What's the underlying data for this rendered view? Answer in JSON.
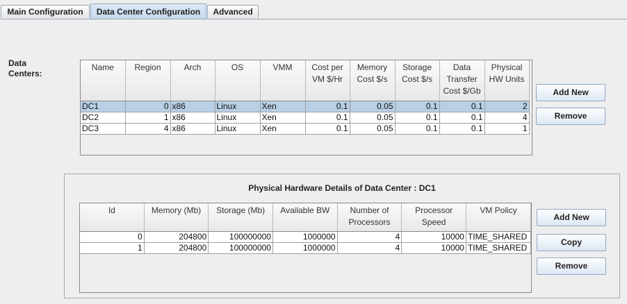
{
  "tabs": [
    {
      "label": "Main Configuration",
      "active": false
    },
    {
      "label": "Data Center Configuration",
      "active": true
    },
    {
      "label": "Advanced",
      "active": false
    }
  ],
  "data_centers": {
    "label": "Data\nCenters:",
    "columns": [
      "Name",
      "Region",
      "Arch",
      "OS",
      "VMM",
      "Cost per VM $/Hr",
      "Memory Cost $/s",
      "Storage Cost $/s",
      "Data Transfer Cost $/Gb",
      "Physical HW Units"
    ],
    "rows": [
      [
        "DC1",
        "0",
        "x86",
        "Linux",
        "Xen",
        "0.1",
        "0.05",
        "0.1",
        "0.1",
        "2"
      ],
      [
        "DC2",
        "1",
        "x86",
        "Linux",
        "Xen",
        "0.1",
        "0.05",
        "0.1",
        "0.1",
        "4"
      ],
      [
        "DC3",
        "4",
        "x86",
        "Linux",
        "Xen",
        "0.1",
        "0.05",
        "0.1",
        "0.1",
        "1"
      ]
    ],
    "selected_row": 0,
    "add_new_label": "Add New",
    "remove_label": "Remove"
  },
  "hardware": {
    "title": "Physical Hardware Details of Data Center : DC1",
    "columns": [
      "Id",
      "Memory (Mb)",
      "Storage (Mb)",
      "Available BW",
      "Number of Processors",
      "Processor Speed",
      "VM Policy"
    ],
    "rows": [
      [
        "0",
        "204800",
        "100000000",
        "1000000",
        "4",
        "10000",
        "TIME_SHARED"
      ],
      [
        "1",
        "204800",
        "100000000",
        "1000000",
        "4",
        "10000",
        "TIME_SHARED"
      ]
    ],
    "add_new_label": "Add New",
    "copy_label": "Copy",
    "remove_label": "Remove"
  }
}
